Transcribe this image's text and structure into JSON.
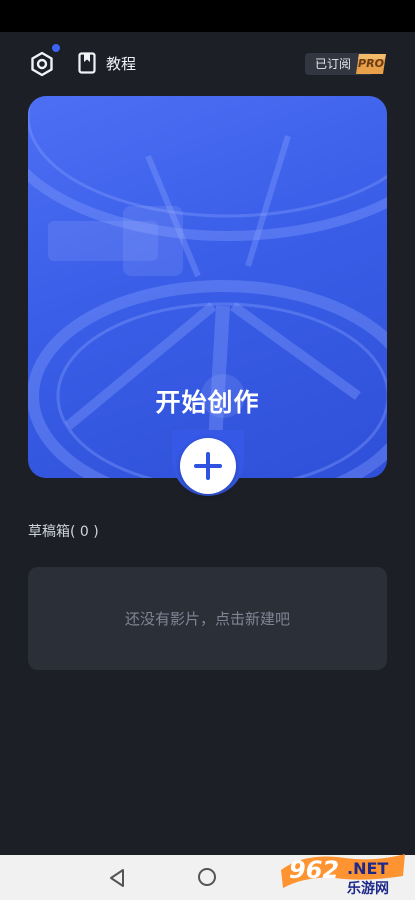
{
  "header": {
    "tutorial_label": "教程",
    "subscribed_label": "已订阅",
    "pro_badge": "PRO"
  },
  "hero": {
    "title": "开始创作"
  },
  "drafts": {
    "title": "草稿箱( 0 )",
    "empty_message": "还没有影片，点击新建吧"
  },
  "watermark": {
    "number": "962",
    "suffix": ".NET",
    "subtitle": "乐游网"
  },
  "colors": {
    "background": "#1c1f26",
    "accent_blue": "#3e63f2",
    "card": "#2b2f38"
  },
  "icons": [
    "settings-hex-icon",
    "bookmark-icon",
    "plus-icon",
    "back-triangle-icon",
    "home-circle-icon"
  ]
}
